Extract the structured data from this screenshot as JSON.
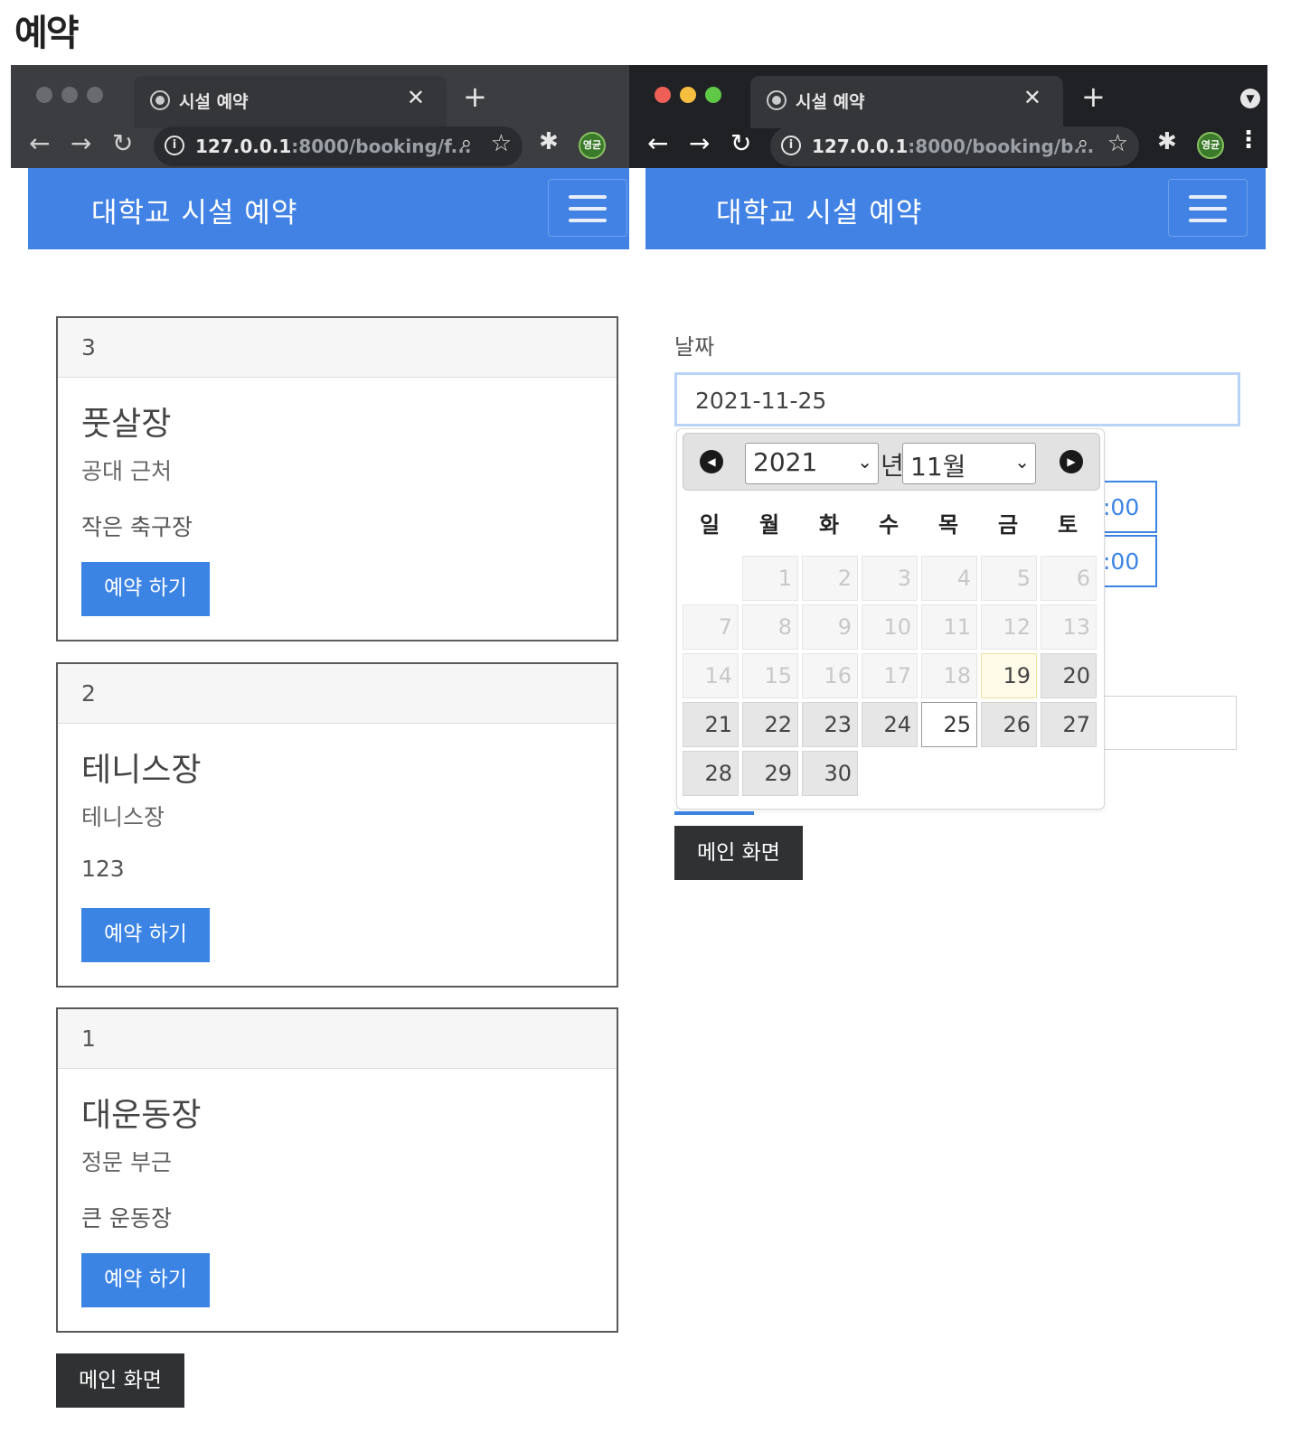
{
  "page_title": "예약",
  "left": {
    "tab_title": "시설 예약",
    "url_host": "127.0.0.1",
    "url_rest": ":8000/booking/f...",
    "avatar_text": "영균",
    "brand": "대학교 시설 예약",
    "cards": [
      {
        "id": "3",
        "title": "풋살장",
        "subtitle": "공대 근처",
        "text": "작은 축구장",
        "button": "예약 하기"
      },
      {
        "id": "2",
        "title": "테니스장",
        "subtitle": "테니스장",
        "text": "123",
        "button": "예약 하기"
      },
      {
        "id": "1",
        "title": "대운동장",
        "subtitle": "정문 부근",
        "text": "큰 운동장",
        "button": "예약 하기"
      }
    ],
    "main_button": "메인 화면"
  },
  "right": {
    "tab_title": "시설 예약",
    "url_host": "127.0.0.1",
    "url_rest": ":8000/booking/b...",
    "avatar_text": "영균",
    "brand": "대학교 시설 예약",
    "date_label": "날짜",
    "date_value": "2021-11-25",
    "time_slots": [
      ":00",
      ":00"
    ],
    "main_button": "메인 화면",
    "datepicker": {
      "year": "2021",
      "year_suffix": "년",
      "month": "11월",
      "weekdays": [
        "일",
        "월",
        "화",
        "수",
        "목",
        "금",
        "토"
      ],
      "first_weekday_index": 1,
      "days_in_month": 30,
      "today": 19,
      "selected": 25,
      "first_selectable": 19
    }
  },
  "icons": {
    "back": "arrow-left-icon",
    "forward": "arrow-right-icon",
    "reload": "reload-icon",
    "info": "info-icon",
    "zoom": "zoom-icon",
    "bookmark": "star-icon",
    "extensions": "puzzle-icon",
    "menu": "hamburger-icon"
  },
  "colors": {
    "navbar": "#4182e4",
    "primary_button": "#3c84e4",
    "dark_button": "#2f3133",
    "chrome_dark": "#202124"
  }
}
